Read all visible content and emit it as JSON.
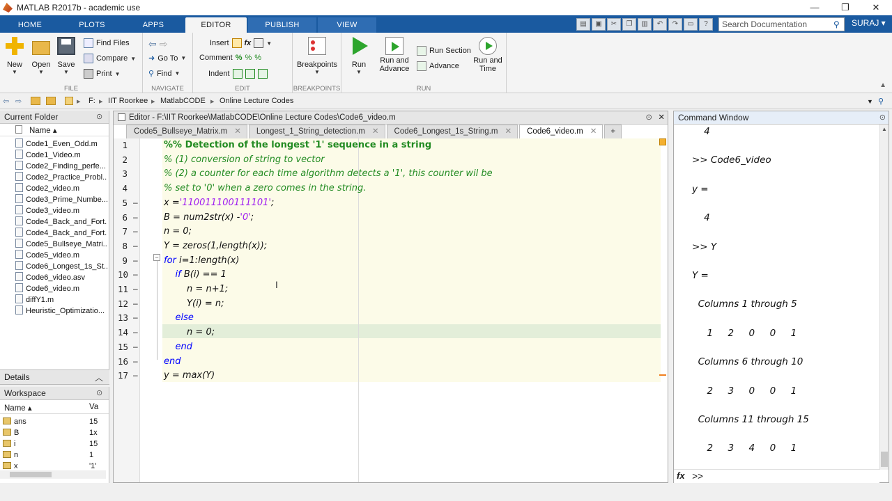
{
  "window": {
    "title": "MATLAB R2017b - academic use",
    "minimize": "—",
    "restore": "❐",
    "close": "✕"
  },
  "ribbon_tabs": [
    "HOME",
    "PLOTS",
    "APPS",
    "EDITOR",
    "PUBLISH",
    "VIEW"
  ],
  "search": {
    "placeholder": "Search Documentation"
  },
  "user": "SURAJ ▾",
  "toolstrip": {
    "file": {
      "new": "New",
      "open": "Open",
      "save": "Save",
      "find_files": "Find Files",
      "compare": "Compare",
      "print": "Print",
      "label": "FILE"
    },
    "navigate": {
      "go_to": "Go To",
      "find": "Find",
      "label": "NAVIGATE"
    },
    "edit": {
      "insert": "Insert",
      "comment": "Comment",
      "indent": "Indent",
      "fx": "fx",
      "label": "EDIT"
    },
    "breakpoints": {
      "breakpoints": "Breakpoints",
      "label": "BREAKPOINTS"
    },
    "run": {
      "run": "Run",
      "run_and_advance_1": "Run and",
      "run_and_advance_2": "Advance",
      "run_section": "Run Section",
      "advance": "Advance",
      "run_and_time_1": "Run and",
      "run_and_time_2": "Time",
      "label": "RUN"
    }
  },
  "address": [
    "F:",
    "IIT Roorkee",
    "MatlabCODE",
    "Online Lecture Codes"
  ],
  "current_folder": {
    "title": "Current Folder",
    "col_name": "Name ▴",
    "files": [
      "Code1_Even_Odd.m",
      "Code1_Video.m",
      "Code2_Finding_perfe...",
      "Code2_Practice_Probl...",
      "Code2_video.m",
      "Code3_Prime_Numbe...",
      "Code3_video.m",
      "Code4_Back_and_Fort...",
      "Code4_Back_and_Fort...",
      "Code5_Bullseye_Matri...",
      "Code5_video.m",
      "Code6_Longest_1s_St...",
      "Code6_video.asv",
      "Code6_video.m",
      "diffY1.m",
      "Heuristic_Optimizatio..."
    ]
  },
  "details": {
    "title": "Details"
  },
  "workspace": {
    "title": "Workspace",
    "col_name": "Name ▴",
    "col_value": "Va",
    "rows": [
      {
        "name": "ans",
        "value": "15"
      },
      {
        "name": "B",
        "value": "1x"
      },
      {
        "name": "i",
        "value": "15"
      },
      {
        "name": "n",
        "value": "1"
      },
      {
        "name": "x",
        "value": "'1'"
      }
    ]
  },
  "editor": {
    "title": "Editor - F:\\IIT Roorkee\\MatlabCODE\\Online Lecture Codes\\Code6_video.m",
    "tabs": [
      {
        "label": "Code5_Bullseye_Matrix.m",
        "active": false
      },
      {
        "label": "Longest_1_String_detection.m",
        "active": false
      },
      {
        "label": "Code6_Longest_1s_String.m",
        "active": false
      },
      {
        "label": "Code6_video.m",
        "active": true
      }
    ],
    "add_tab": "+",
    "lines": [
      {
        "n": "1",
        "dash": "",
        "parts": [
          {
            "t": "%% Detection of the longest '1' sequence in a string",
            "c": "cmt bold"
          }
        ]
      },
      {
        "n": "2",
        "dash": "",
        "parts": [
          {
            "t": "% (1) conversion of string to vector",
            "c": "cmt"
          }
        ]
      },
      {
        "n": "3",
        "dash": "",
        "parts": [
          {
            "t": "% (2) a counter for each time algorithm detects a '1', this counter wil be",
            "c": "cmt"
          }
        ]
      },
      {
        "n": "4",
        "dash": "",
        "parts": [
          {
            "t": "% set to '0' when a zero comes in the string.",
            "c": "cmt"
          }
        ]
      },
      {
        "n": "5",
        "dash": "–",
        "parts": [
          {
            "t": "x =",
            "c": ""
          },
          {
            "t": "'110011100111101'",
            "c": "str"
          },
          {
            "t": ";",
            "c": ""
          }
        ]
      },
      {
        "n": "6",
        "dash": "–",
        "parts": [
          {
            "t": "B = num2str(x) -",
            "c": ""
          },
          {
            "t": "'0'",
            "c": "str"
          },
          {
            "t": ";",
            "c": ""
          }
        ]
      },
      {
        "n": "7",
        "dash": "–",
        "parts": [
          {
            "t": "n = 0;",
            "c": ""
          }
        ]
      },
      {
        "n": "8",
        "dash": "–",
        "parts": [
          {
            "t": "Y = zeros(1,length(x));",
            "c": ""
          }
        ]
      },
      {
        "n": "9",
        "dash": "–",
        "parts": [
          {
            "t": "for",
            "c": "kw"
          },
          {
            "t": " i=1:length(x)",
            "c": ""
          }
        ]
      },
      {
        "n": "10",
        "dash": "–",
        "parts": [
          {
            "t": "    ",
            "c": ""
          },
          {
            "t": "if",
            "c": "kw"
          },
          {
            "t": " B(i) == 1",
            "c": ""
          }
        ]
      },
      {
        "n": "11",
        "dash": "–",
        "parts": [
          {
            "t": "        n = n+1;",
            "c": ""
          }
        ]
      },
      {
        "n": "12",
        "dash": "–",
        "parts": [
          {
            "t": "        Y(i) = n;",
            "c": ""
          }
        ]
      },
      {
        "n": "13",
        "dash": "–",
        "parts": [
          {
            "t": "    ",
            "c": ""
          },
          {
            "t": "else",
            "c": "kw"
          }
        ]
      },
      {
        "n": "14",
        "dash": "–",
        "parts": [
          {
            "t": "        n = 0;",
            "c": ""
          }
        ]
      },
      {
        "n": "15",
        "dash": "–",
        "parts": [
          {
            "t": "    ",
            "c": ""
          },
          {
            "t": "end",
            "c": "kw"
          }
        ]
      },
      {
        "n": "16",
        "dash": "–",
        "parts": [
          {
            "t": "end",
            "c": "kw"
          }
        ]
      },
      {
        "n": "17",
        "dash": "–",
        "parts": [
          {
            "t": "y = max(Y)",
            "c": ""
          }
        ]
      }
    ]
  },
  "command_window": {
    "title": "Command Window",
    "lines": [
      "    4",
      "",
      ">> Code6_video",
      "",
      "y =",
      "",
      "    4",
      "",
      ">> Y",
      "",
      "Y =",
      "",
      "  Columns 1 through 5",
      "",
      "     1     2     0     0     1",
      "",
      "  Columns 6 through 10",
      "",
      "     2     3     0     0     1",
      "",
      "  Columns 11 through 15",
      "",
      "     2     3     4     0     1"
    ],
    "prompt_fx": "fx",
    "prompt": ">>"
  },
  "colors": {
    "ribbon_blue": "#1a5aa0",
    "comment_green": "#228b22",
    "string_purple": "#a020f0",
    "keyword_blue": "#0000ff"
  }
}
